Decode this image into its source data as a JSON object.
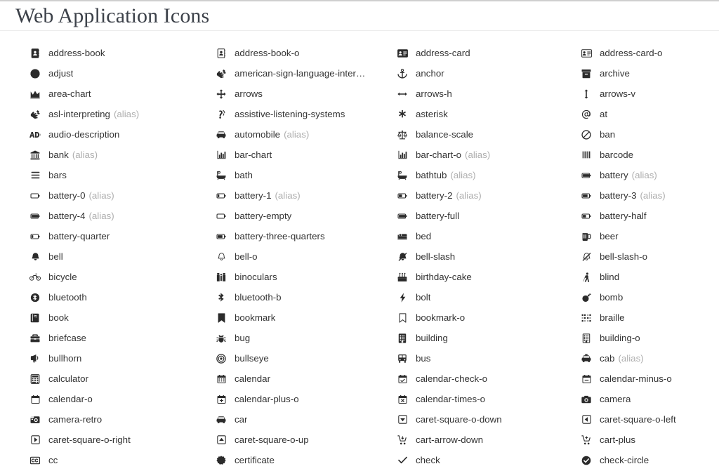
{
  "header": {
    "title": "Web Application Icons"
  },
  "alias_label": "(alias)",
  "colors": {
    "title": "#3c4149",
    "label": "#333333",
    "alias": "#aeaeae",
    "icon": "#2b2b2b",
    "top_rule": "#cfcfcf",
    "title_rule": "#ededed",
    "background": "#ffffff"
  },
  "columns": 4,
  "icons": [
    {
      "name": "address-book",
      "icon": "address-book-icon",
      "alias": false
    },
    {
      "name": "address-book-o",
      "icon": "address-book-o-icon",
      "alias": false
    },
    {
      "name": "address-card",
      "icon": "address-card-icon",
      "alias": false
    },
    {
      "name": "address-card-o",
      "icon": "address-card-o-icon",
      "alias": false
    },
    {
      "name": "adjust",
      "icon": "adjust-icon",
      "alias": false
    },
    {
      "name": "american-sign-language-interpr…",
      "icon": "american-sign-language-interpreting-icon",
      "alias": false,
      "truncated": true
    },
    {
      "name": "anchor",
      "icon": "anchor-icon",
      "alias": false
    },
    {
      "name": "archive",
      "icon": "archive-icon",
      "alias": false
    },
    {
      "name": "area-chart",
      "icon": "area-chart-icon",
      "alias": false
    },
    {
      "name": "arrows",
      "icon": "arrows-icon",
      "alias": false
    },
    {
      "name": "arrows-h",
      "icon": "arrows-h-icon",
      "alias": false
    },
    {
      "name": "arrows-v",
      "icon": "arrows-v-icon",
      "alias": false
    },
    {
      "name": "asl-interpreting",
      "icon": "asl-interpreting-icon",
      "alias": true
    },
    {
      "name": "assistive-listening-systems",
      "icon": "assistive-listening-systems-icon",
      "alias": false
    },
    {
      "name": "asterisk",
      "icon": "asterisk-icon",
      "alias": false
    },
    {
      "name": "at",
      "icon": "at-icon",
      "alias": false
    },
    {
      "name": "audio-description",
      "icon": "audio-description-icon",
      "alias": false
    },
    {
      "name": "automobile",
      "icon": "automobile-icon",
      "alias": true
    },
    {
      "name": "balance-scale",
      "icon": "balance-scale-icon",
      "alias": false
    },
    {
      "name": "ban",
      "icon": "ban-icon",
      "alias": false
    },
    {
      "name": "bank",
      "icon": "bank-icon",
      "alias": true
    },
    {
      "name": "bar-chart",
      "icon": "bar-chart-icon",
      "alias": false
    },
    {
      "name": "bar-chart-o",
      "icon": "bar-chart-o-icon",
      "alias": true
    },
    {
      "name": "barcode",
      "icon": "barcode-icon",
      "alias": false
    },
    {
      "name": "bars",
      "icon": "bars-icon",
      "alias": false
    },
    {
      "name": "bath",
      "icon": "bath-icon",
      "alias": false
    },
    {
      "name": "bathtub",
      "icon": "bathtub-icon",
      "alias": true
    },
    {
      "name": "battery",
      "icon": "battery-icon",
      "alias": true
    },
    {
      "name": "battery-0",
      "icon": "battery-0-icon",
      "alias": true
    },
    {
      "name": "battery-1",
      "icon": "battery-1-icon",
      "alias": true
    },
    {
      "name": "battery-2",
      "icon": "battery-2-icon",
      "alias": true
    },
    {
      "name": "battery-3",
      "icon": "battery-3-icon",
      "alias": true
    },
    {
      "name": "battery-4",
      "icon": "battery-4-icon",
      "alias": true
    },
    {
      "name": "battery-empty",
      "icon": "battery-empty-icon",
      "alias": false
    },
    {
      "name": "battery-full",
      "icon": "battery-full-icon",
      "alias": false
    },
    {
      "name": "battery-half",
      "icon": "battery-half-icon",
      "alias": false
    },
    {
      "name": "battery-quarter",
      "icon": "battery-quarter-icon",
      "alias": false
    },
    {
      "name": "battery-three-quarters",
      "icon": "battery-three-quarters-icon",
      "alias": false
    },
    {
      "name": "bed",
      "icon": "bed-icon",
      "alias": false
    },
    {
      "name": "beer",
      "icon": "beer-icon",
      "alias": false
    },
    {
      "name": "bell",
      "icon": "bell-icon",
      "alias": false
    },
    {
      "name": "bell-o",
      "icon": "bell-o-icon",
      "alias": false
    },
    {
      "name": "bell-slash",
      "icon": "bell-slash-icon",
      "alias": false
    },
    {
      "name": "bell-slash-o",
      "icon": "bell-slash-o-icon",
      "alias": false
    },
    {
      "name": "bicycle",
      "icon": "bicycle-icon",
      "alias": false
    },
    {
      "name": "binoculars",
      "icon": "binoculars-icon",
      "alias": false
    },
    {
      "name": "birthday-cake",
      "icon": "birthday-cake-icon",
      "alias": false
    },
    {
      "name": "blind",
      "icon": "blind-icon",
      "alias": false
    },
    {
      "name": "bluetooth",
      "icon": "bluetooth-icon",
      "alias": false
    },
    {
      "name": "bluetooth-b",
      "icon": "bluetooth-b-icon",
      "alias": false
    },
    {
      "name": "bolt",
      "icon": "bolt-icon",
      "alias": false
    },
    {
      "name": "bomb",
      "icon": "bomb-icon",
      "alias": false
    },
    {
      "name": "book",
      "icon": "book-icon",
      "alias": false
    },
    {
      "name": "bookmark",
      "icon": "bookmark-icon",
      "alias": false
    },
    {
      "name": "bookmark-o",
      "icon": "bookmark-o-icon",
      "alias": false
    },
    {
      "name": "braille",
      "icon": "braille-icon",
      "alias": false
    },
    {
      "name": "briefcase",
      "icon": "briefcase-icon",
      "alias": false
    },
    {
      "name": "bug",
      "icon": "bug-icon",
      "alias": false
    },
    {
      "name": "building",
      "icon": "building-icon",
      "alias": false
    },
    {
      "name": "building-o",
      "icon": "building-o-icon",
      "alias": false
    },
    {
      "name": "bullhorn",
      "icon": "bullhorn-icon",
      "alias": false
    },
    {
      "name": "bullseye",
      "icon": "bullseye-icon",
      "alias": false
    },
    {
      "name": "bus",
      "icon": "bus-icon",
      "alias": false
    },
    {
      "name": "cab",
      "icon": "cab-icon",
      "alias": true
    },
    {
      "name": "calculator",
      "icon": "calculator-icon",
      "alias": false
    },
    {
      "name": "calendar",
      "icon": "calendar-icon",
      "alias": false
    },
    {
      "name": "calendar-check-o",
      "icon": "calendar-check-o-icon",
      "alias": false
    },
    {
      "name": "calendar-minus-o",
      "icon": "calendar-minus-o-icon",
      "alias": false
    },
    {
      "name": "calendar-o",
      "icon": "calendar-o-icon",
      "alias": false
    },
    {
      "name": "calendar-plus-o",
      "icon": "calendar-plus-o-icon",
      "alias": false
    },
    {
      "name": "calendar-times-o",
      "icon": "calendar-times-o-icon",
      "alias": false
    },
    {
      "name": "camera",
      "icon": "camera-icon",
      "alias": false
    },
    {
      "name": "camera-retro",
      "icon": "camera-retro-icon",
      "alias": false
    },
    {
      "name": "car",
      "icon": "car-icon",
      "alias": false
    },
    {
      "name": "caret-square-o-down",
      "icon": "caret-square-o-down-icon",
      "alias": false
    },
    {
      "name": "caret-square-o-left",
      "icon": "caret-square-o-left-icon",
      "alias": false
    },
    {
      "name": "caret-square-o-right",
      "icon": "caret-square-o-right-icon",
      "alias": false
    },
    {
      "name": "caret-square-o-up",
      "icon": "caret-square-o-up-icon",
      "alias": false
    },
    {
      "name": "cart-arrow-down",
      "icon": "cart-arrow-down-icon",
      "alias": false
    },
    {
      "name": "cart-plus",
      "icon": "cart-plus-icon",
      "alias": false
    },
    {
      "name": "cc",
      "icon": "cc-icon",
      "alias": false
    },
    {
      "name": "certificate",
      "icon": "certificate-icon",
      "alias": false
    },
    {
      "name": "check",
      "icon": "check-icon",
      "alias": false
    },
    {
      "name": "check-circle",
      "icon": "check-circle-icon",
      "alias": false
    }
  ]
}
